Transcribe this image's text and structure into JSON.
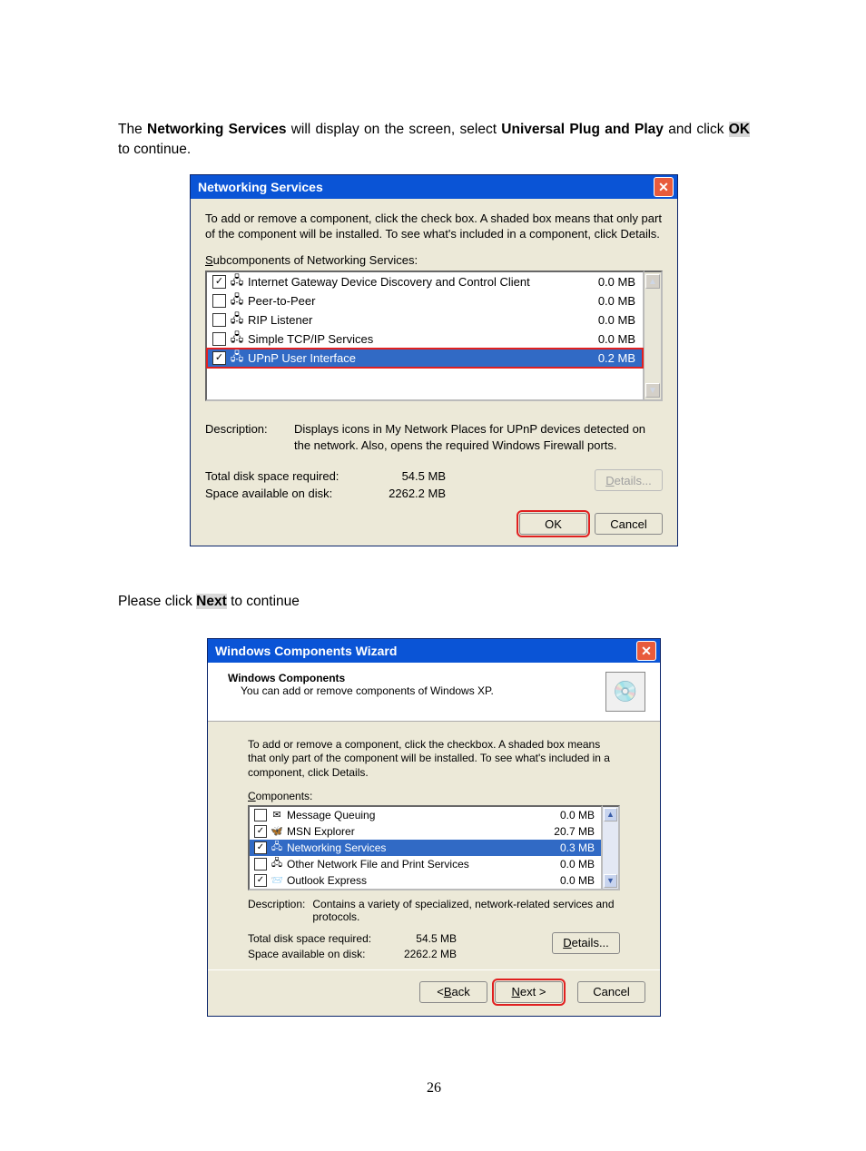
{
  "page_number": "26",
  "instr1_parts": {
    "p1": "The ",
    "p2_bold": "Networking Services",
    "p3": " will display on the screen, select ",
    "p4_bold": "Universal Plug and Play",
    "p5": " and click ",
    "p6_boldhl": "OK",
    "p7": " to continue."
  },
  "instr2_parts": {
    "p1": "Please click ",
    "p2_boldhl": "Next",
    "p3": " to continue"
  },
  "dialog1": {
    "title": "Networking Services",
    "explain": "To add or remove a component, click the check box. A shaded box means that only part of the component will be installed. To see what's included in a component, click Details.",
    "list_label": "Subcomponents of Networking Services:",
    "items": [
      {
        "checked": true,
        "name": "Internet Gateway Device Discovery and Control Client",
        "size": "0.0 MB",
        "selected": false,
        "highlight": false
      },
      {
        "checked": false,
        "name": "Peer-to-Peer",
        "size": "0.0 MB",
        "selected": false,
        "highlight": false
      },
      {
        "checked": false,
        "name": "RIP Listener",
        "size": "0.0 MB",
        "selected": false,
        "highlight": false
      },
      {
        "checked": false,
        "name": "Simple TCP/IP Services",
        "size": "0.0 MB",
        "selected": false,
        "highlight": false
      },
      {
        "checked": true,
        "name": "UPnP User Interface",
        "size": "0.2 MB",
        "selected": true,
        "highlight": true
      }
    ],
    "description_label": "Description:",
    "description_value": "Displays icons in My Network Places for UPnP devices detected on the network. Also, opens the required Windows Firewall ports.",
    "total_label": "Total disk space required:",
    "total_value": "54.5 MB",
    "avail_label": "Space available on disk:",
    "avail_value": "2262.2 MB",
    "details_btn": "Details...",
    "ok_btn": "OK",
    "cancel_btn": "Cancel"
  },
  "dialog2": {
    "title": "Windows Components Wizard",
    "header_title": "Windows Components",
    "header_sub": "You can add or remove components of Windows XP.",
    "explain": "To add or remove a component, click the checkbox.  A shaded box means that only part of the component will be installed.  To see what's included in a component, click Details.",
    "list_label": "Components:",
    "items": [
      {
        "checked": false,
        "icon": "✉",
        "name": "Message Queuing",
        "size": "0.0 MB",
        "selected": false,
        "highlight": false
      },
      {
        "checked": true,
        "icon": "🦋",
        "name": "MSN Explorer",
        "size": "20.7 MB",
        "selected": false,
        "highlight": false
      },
      {
        "checked": true,
        "icon": "🖧",
        "name": "Networking Services",
        "size": "0.3 MB",
        "selected": true,
        "highlight": true
      },
      {
        "checked": false,
        "icon": "🖧",
        "name": "Other Network File and Print Services",
        "size": "0.0 MB",
        "selected": false,
        "highlight": false
      },
      {
        "checked": true,
        "icon": "📨",
        "name": "Outlook Express",
        "size": "0.0 MB",
        "selected": false,
        "highlight": false
      }
    ],
    "description_label": "Description:",
    "description_value": "Contains a variety of specialized, network-related services and protocols.",
    "total_label": "Total disk space required:",
    "total_value": "54.5 MB",
    "avail_label": "Space available on disk:",
    "avail_value": "2262.2 MB",
    "details_btn": "Details...",
    "back_btn": "< Back",
    "next_btn": "Next >",
    "cancel_btn": "Cancel"
  }
}
